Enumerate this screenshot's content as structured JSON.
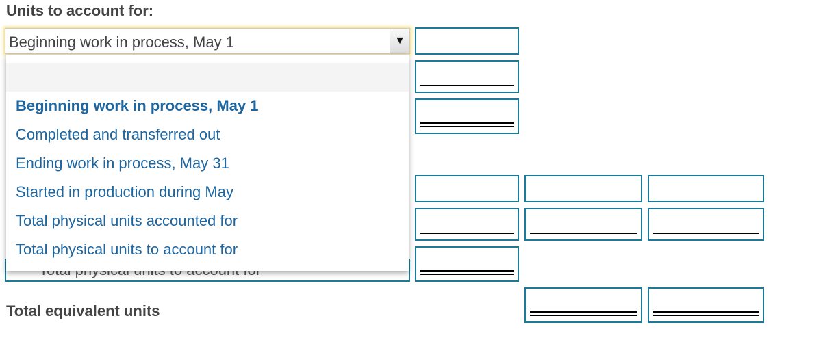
{
  "headings": {
    "units_to_account_for": "Units to account for:",
    "total_equivalent_units": "Total equivalent units"
  },
  "select": {
    "value": "Beginning work in process, May 1",
    "arrow_icon": "▼"
  },
  "dropdown": {
    "options": [
      "",
      "Beginning work in process, May 1",
      "Completed and transferred out",
      "Ending work in process, May 31",
      "Started in production during May",
      "Total physical units accounted for",
      "Total physical units to account for"
    ],
    "selected_index": 1
  },
  "background_select": {
    "value": "Total physical units to account for"
  },
  "colors": {
    "input_border": "#1a7a99",
    "option_text": "#1e66a0",
    "focus_glow": "#f7e07a"
  }
}
